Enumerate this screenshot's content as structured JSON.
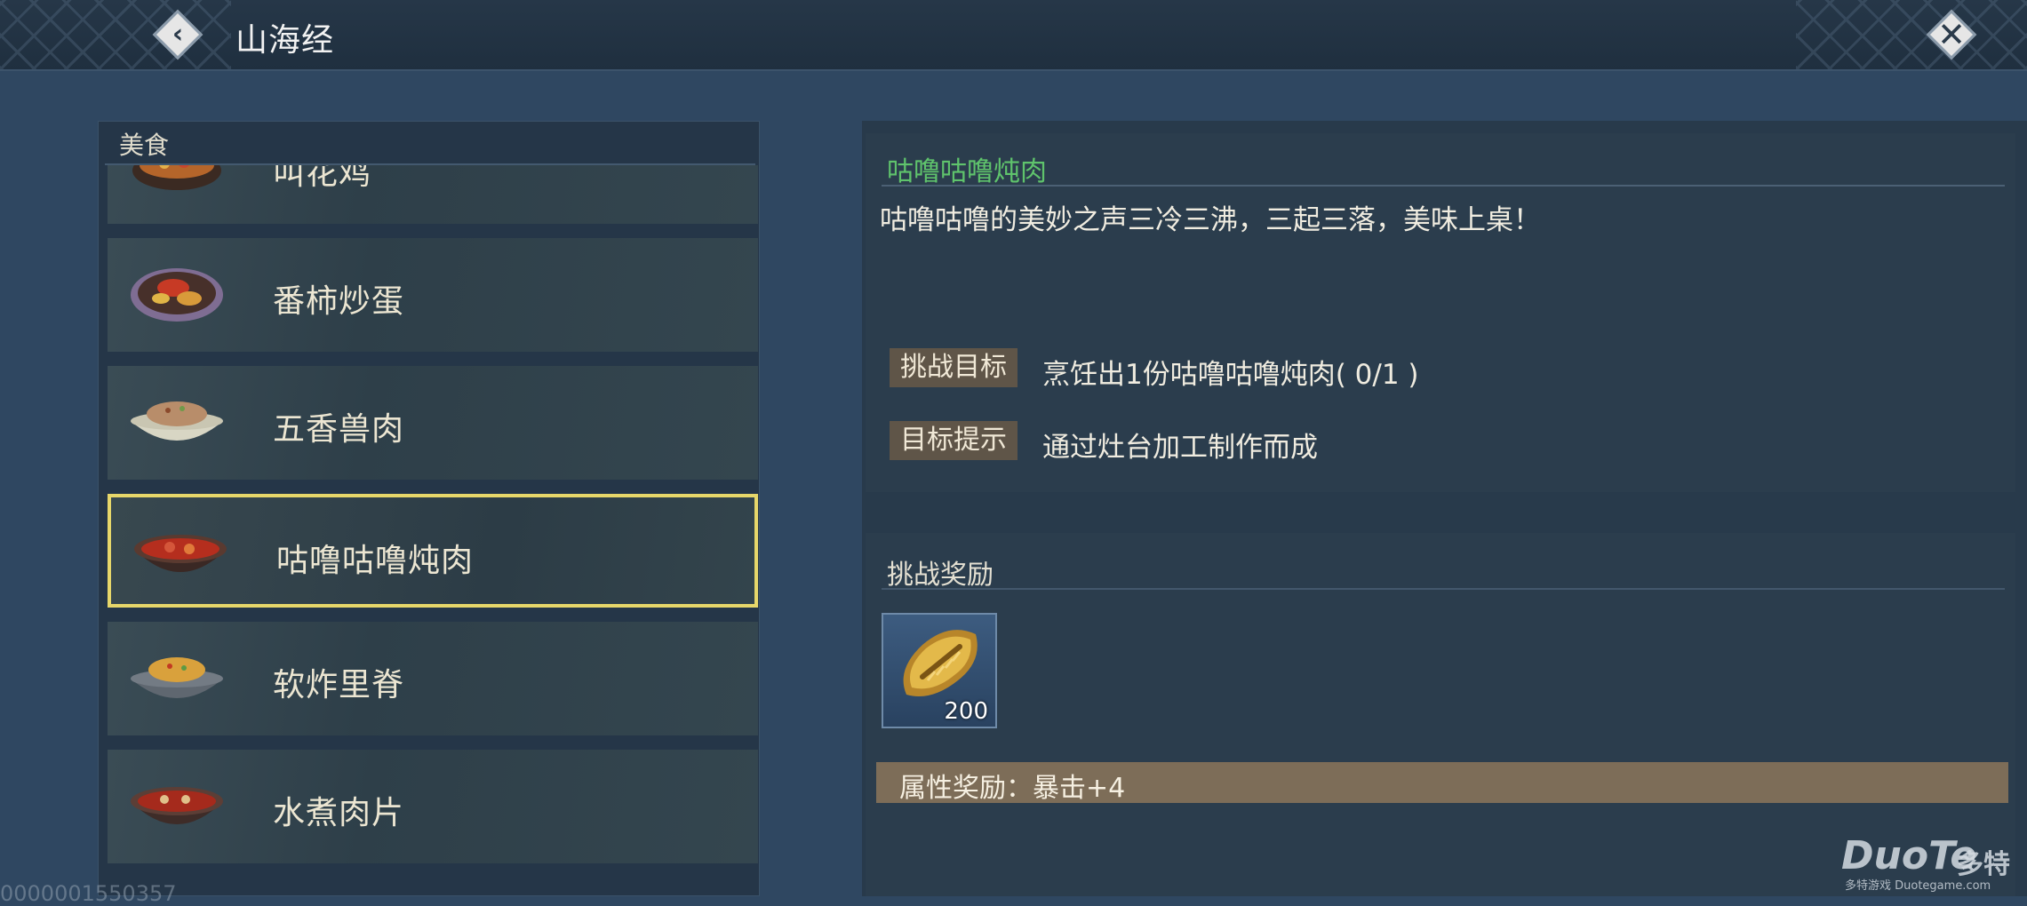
{
  "header": {
    "title": "山海经",
    "back_icon": "back-arrow-icon",
    "close_icon": "close-x-icon"
  },
  "category": {
    "label": "美食"
  },
  "food_list": [
    {
      "label": "叫花鸡",
      "icon": "dish-icon",
      "selected": false
    },
    {
      "label": "番柿炒蛋",
      "icon": "dish-icon",
      "selected": false
    },
    {
      "label": "五香兽肉",
      "icon": "dish-icon",
      "selected": false
    },
    {
      "label": "咕噜咕噜炖肉",
      "icon": "dish-icon",
      "selected": true
    },
    {
      "label": "软炸里脊",
      "icon": "dish-icon",
      "selected": false
    },
    {
      "label": "水煮肉片",
      "icon": "dish-icon",
      "selected": false
    }
  ],
  "detail": {
    "name": "咕噜咕噜炖肉",
    "description": "咕噜咕噜的美妙之声三冷三沸，三起三落，美味上桌！",
    "goal_tag": "挑战目标",
    "goal_text": "烹饪出1份咕噜咕噜炖肉( 0/1 )",
    "hint_tag": "目标提示",
    "hint_text": "通过灶台加工制作而成"
  },
  "reward": {
    "title": "挑战奖励",
    "item_icon": "gold-coin-icon",
    "item_count": "200",
    "attribute": "属性奖励：暴击+4"
  },
  "watermark": {
    "main": "DuoTe",
    "cn": "多特",
    "sub": "多特游戏 Duotegame.com"
  },
  "footer_id": "0000001550357",
  "colors": {
    "accent_green": "#5fc36c",
    "selection_border": "#e7d76a",
    "tag_bg": "#5f5548"
  }
}
